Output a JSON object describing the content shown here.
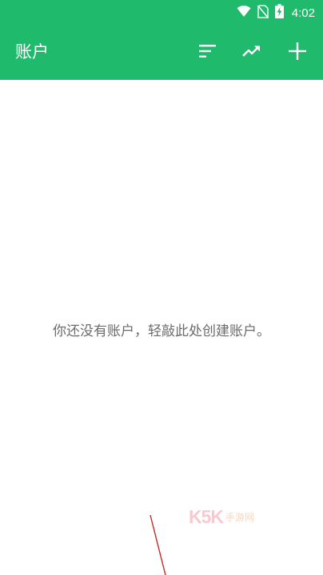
{
  "status_bar": {
    "time": "4:02",
    "icons": [
      "wifi-icon",
      "no-sim-icon",
      "battery-charging-icon"
    ]
  },
  "app_bar": {
    "title": "账户",
    "actions": [
      "sort-icon",
      "trending-up-icon",
      "add-icon"
    ]
  },
  "empty_state": {
    "message": "你还没有账户，轻敲此处创建账户。"
  },
  "watermark": {
    "logo": "K5K",
    "sub": "手游网"
  },
  "colors": {
    "primary": "#1fba6c",
    "on_primary": "#ffffff",
    "background": "#ffffff",
    "empty_text": "#6b6b6b"
  }
}
